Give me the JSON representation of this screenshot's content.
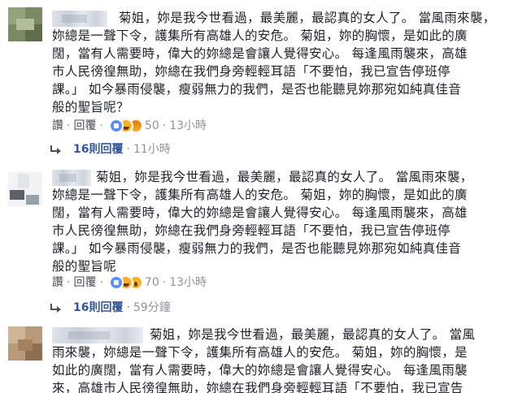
{
  "comments": [
    {
      "lines": [
        "菊姐，妳是我今世看過，最美麗，最認真的女人了。 當風雨來襲，",
        "妳總是一聲下令，護集所有高雄人的安危。 菊姐，妳的胸懷，是如此的廣",
        "闊，當有人需要時，偉大的妳總是會讓人覺得安心。 每逢風雨襲來，高雄",
        "市人民徬徨無助，妳總在我們身旁輕輕耳語「不要怕，我已宣告停班停",
        "課。」 如今暴雨侵襲，瘦弱無力的我們，是否也能聽見妳那宛如純真佳音",
        "般的聖旨呢？"
      ],
      "like_label": "讚",
      "reply_label": "回覆",
      "reaction_icons": [
        "like-icon",
        "haha-icon",
        "angry-icon"
      ],
      "reaction_count": "50",
      "time": "13小時",
      "replies_label": "16則回覆",
      "replies_time": "11小時"
    },
    {
      "lines": [
        "菊姐，妳是我今世看過，最美麗，最認真的女人了。 當風雨來襲，",
        "妳總是一聲下令，護集所有高雄人的安危。 菊姐，妳的胸懷，是如此的廣",
        "闊，當有人需要時，偉大的妳總是會讓人覺得安心。 每逢風雨襲來，高雄",
        "市人民徬徨無助，妳總在我們身旁輕輕耳語「不要怕，我已宣告停班停",
        "課。」 如今暴雨侵襲，瘦弱無力的我們，是否也能聽見妳那宛如純真佳音",
        "般的聖旨呢"
      ],
      "like_label": "讚",
      "reply_label": "回覆",
      "reaction_icons": [
        "like-icon",
        "haha-icon",
        "wow-icon"
      ],
      "reaction_count": "70",
      "time": "13小時",
      "replies_label": "16則回覆",
      "replies_time": "59分鐘"
    },
    {
      "lines": [
        "菊姐，妳是我今世看過，最美麗，最認真的女人了。 當風",
        "雨來襲，妳總是一聲下令，護集所有高雄人的安危。 菊姐，妳的胸懷，是",
        "如此的廣闊，當有人需要時，偉大的妳總是會讓人覺得安心。 每逢風雨襲",
        "來，高雄市人民徬徨無助，妳總在我們身旁輕輕耳語「不要怕，我已宣告"
      ]
    }
  ],
  "colors": {
    "text": "#1d2129",
    "meta": "#90949c",
    "link": "#365899",
    "like": "#5890ff",
    "haha": "#f7b125"
  }
}
